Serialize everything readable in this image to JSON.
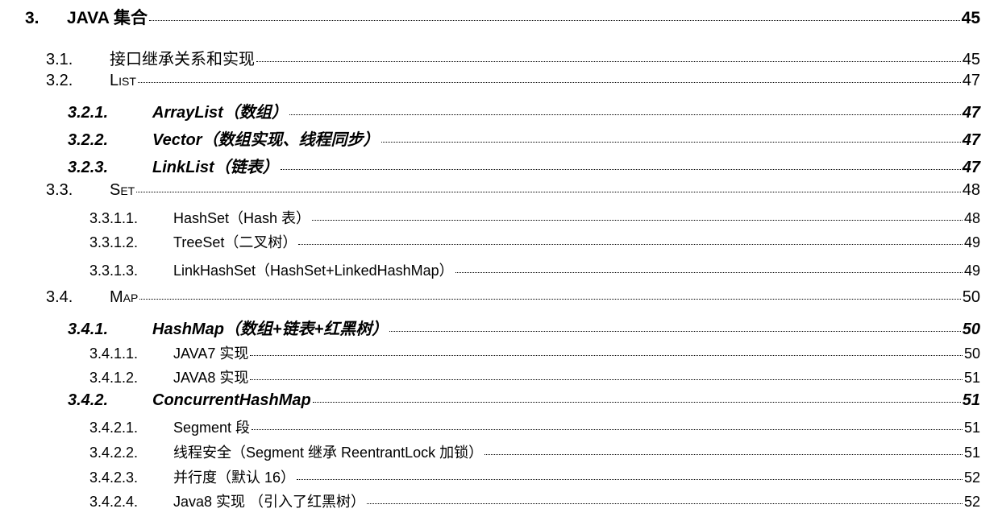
{
  "toc": [
    {
      "num": "3.",
      "title": "JAVA 集合",
      "page": "45"
    },
    {
      "num": "3.1.",
      "title": "接口继承关系和实现",
      "page": "45"
    },
    {
      "num": "3.2.",
      "title": "List",
      "page": "47"
    },
    {
      "num": "3.2.1.",
      "title": "ArrayList（数组）",
      "page": "47"
    },
    {
      "num": "3.2.2.",
      "title": "Vector（数组实现、线程同步）",
      "page": "47"
    },
    {
      "num": "3.2.3.",
      "title": "LinkList（链表）",
      "page": "47"
    },
    {
      "num": "3.3.",
      "title": "Set",
      "page": "48"
    },
    {
      "num": "3.3.1.1.",
      "title": "HashSet（Hash 表）",
      "page": "48"
    },
    {
      "num": "3.3.1.2.",
      "title": "TreeSet（二叉树）",
      "page": "49"
    },
    {
      "num": "3.3.1.3.",
      "title": "LinkHashSet（HashSet+LinkedHashMap）",
      "page": "49"
    },
    {
      "num": "3.4.",
      "title": "Map",
      "page": "50"
    },
    {
      "num": "3.4.1.",
      "title": "HashMap（数组+链表+红黑树）",
      "page": "50"
    },
    {
      "num": "3.4.1.1.",
      "title": "JAVA7 实现",
      "page": "50"
    },
    {
      "num": "3.4.1.2.",
      "title": "JAVA8 实现",
      "page": "51"
    },
    {
      "num": "3.4.2.",
      "title": "ConcurrentHashMap",
      "page": "51"
    },
    {
      "num": "3.4.2.1.",
      "title": "Segment 段",
      "page": "51"
    },
    {
      "num": "3.4.2.2.",
      "title": "线程安全（Segment 继承 ReentrantLock 加锁）",
      "page": "51"
    },
    {
      "num": "3.4.2.3.",
      "title": "并行度（默认 16）",
      "page": "52"
    },
    {
      "num": "3.4.2.4.",
      "title": "Java8 实现 （引入了红黑树）",
      "page": "52"
    }
  ]
}
